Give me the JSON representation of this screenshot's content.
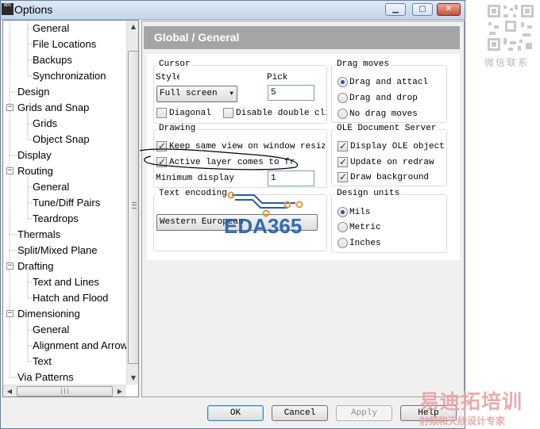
{
  "window": {
    "title": "Options",
    "app_icon_text": "WDS"
  },
  "tree": {
    "items": [
      {
        "label": "General",
        "level": 2,
        "selected": false
      },
      {
        "label": "File Locations",
        "level": 2
      },
      {
        "label": "Backups",
        "level": 2
      },
      {
        "label": "Synchronization",
        "level": 2
      },
      {
        "label": "Design",
        "level": 1
      },
      {
        "label": "Grids and Snap",
        "level": 1,
        "expander": "−"
      },
      {
        "label": "Grids",
        "level": 2
      },
      {
        "label": "Object Snap",
        "level": 2
      },
      {
        "label": "Display",
        "level": 1
      },
      {
        "label": "Routing",
        "level": 1,
        "expander": "−"
      },
      {
        "label": "General",
        "level": 2
      },
      {
        "label": "Tune/Diff Pairs",
        "level": 2
      },
      {
        "label": "Teardrops",
        "level": 2
      },
      {
        "label": "Thermals",
        "level": 1
      },
      {
        "label": "Split/Mixed Plane",
        "level": 1
      },
      {
        "label": "Drafting",
        "level": 1,
        "expander": "−"
      },
      {
        "label": "Text and Lines",
        "level": 2
      },
      {
        "label": "Hatch and Flood",
        "level": 2
      },
      {
        "label": "Dimensioning",
        "level": 1,
        "expander": "−"
      },
      {
        "label": "General",
        "level": 2
      },
      {
        "label": "Alignment and Arrows",
        "level": 2
      },
      {
        "label": "Text",
        "level": 2
      },
      {
        "label": "Via Patterns",
        "level": 1
      }
    ]
  },
  "panel": {
    "header": "Global / General",
    "cursor": {
      "title": "Cursor",
      "style_label": "Style",
      "style_value": "Full screen",
      "pick_label": "Pick",
      "pick_value": "5",
      "diagonal_label": "Diagonal",
      "diagonal_checked": false,
      "disable_double_label": "Disable double cli",
      "disable_double_checked": false
    },
    "drag_moves": {
      "title": "Drag moves",
      "options": [
        {
          "label": "Drag and attacl",
          "checked": true
        },
        {
          "label": "Drag and drop",
          "checked": false
        },
        {
          "label": "No drag moves",
          "checked": false
        }
      ]
    },
    "drawing": {
      "title": "Drawing",
      "keep_same_view_label": "Keep same view on window resiz",
      "keep_same_view_checked": true,
      "active_layer_label": "Active layer comes to fr",
      "active_layer_checked": true,
      "min_display_label": "Minimum display",
      "min_display_value": "1"
    },
    "ole": {
      "title": "OLE Document Server",
      "options": [
        {
          "label": "Display OLE object",
          "checked": true
        },
        {
          "label": "Update on redraw",
          "checked": true
        },
        {
          "label": "Draw background",
          "checked": true
        }
      ]
    },
    "text_encoding": {
      "title": "Text encoding",
      "value": "Western European"
    },
    "design_units": {
      "title": "Design units",
      "options": [
        {
          "label": "Mils",
          "checked": true
        },
        {
          "label": "Metric",
          "checked": false
        },
        {
          "label": "Inches",
          "checked": false
        }
      ]
    }
  },
  "buttons": {
    "ok": "OK",
    "cancel": "Cancel",
    "apply": "Apply",
    "help": "Help"
  },
  "watermarks": {
    "eda_logo": "EDA365",
    "qr_caption": "微信联系",
    "brand_big": "易迪拓培训",
    "brand_small": "射频和天线设计专家"
  },
  "colors": {
    "panel_header_bg": "#a5a5a5",
    "title_gradient_top": "#dde9f6",
    "close_button": "#c7503a",
    "eda_logo": "#1d5fae",
    "watermark_pink": "#e8a3a7"
  }
}
